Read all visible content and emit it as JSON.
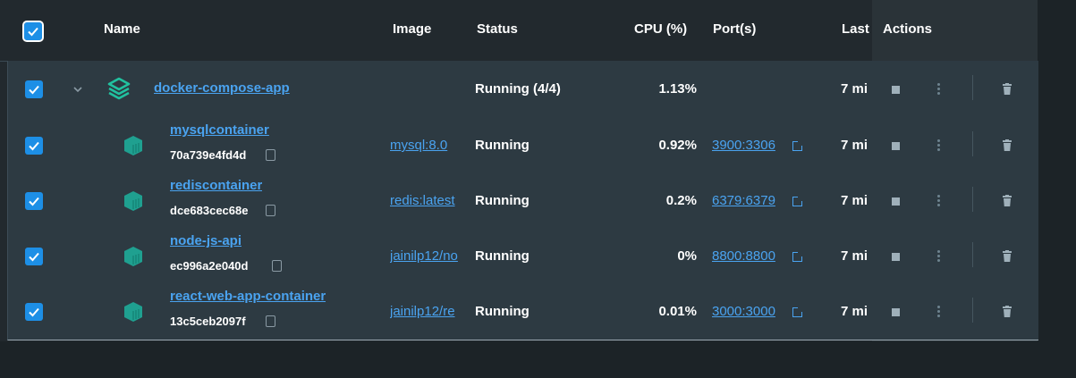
{
  "header": {
    "name": "Name",
    "image": "Image",
    "status": "Status",
    "cpu": "CPU (%)",
    "ports": "Port(s)",
    "last": "Last",
    "actions": "Actions"
  },
  "group": {
    "name": "docker-compose-app",
    "status": "Running (4/4)",
    "cpu": "1.13%",
    "last": "7 mi"
  },
  "containers": [
    {
      "name": "mysqlcontainer",
      "id": "70a739e4fd4d",
      "image": "mysql:8.0",
      "status": "Running",
      "cpu": "0.92%",
      "port": "3900:3306",
      "last": "7 mi"
    },
    {
      "name": "rediscontainer",
      "id": "dce683cec68e",
      "image": "redis:latest",
      "status": "Running",
      "cpu": "0.2%",
      "port": "6379:6379",
      "last": "7 mi"
    },
    {
      "name": "node-js-api",
      "id": "ec996a2e040d",
      "image": "jainilp12/no",
      "status": "Running",
      "cpu": "0%",
      "port": "8800:8800",
      "last": "7 mi"
    },
    {
      "name": "react-web-app-container",
      "id": "13c5ceb2097f",
      "image": "jainilp12/re",
      "status": "Running",
      "cpu": "0.01%",
      "port": "3000:3000",
      "last": "7 mi"
    }
  ],
  "colors": {
    "accent": "#1d8fe6",
    "link": "#4aa3f0",
    "container_icon": "#1fa090",
    "stack_icon": "#21c19f"
  },
  "icons": {
    "checkbox": "check-icon",
    "expand": "chevron-down-icon",
    "stack": "stack-icon",
    "container": "container-icon",
    "copy": "copy-icon",
    "external": "external-link-icon",
    "stop": "stop-icon",
    "more": "kebab-icon",
    "delete": "trash-icon"
  }
}
